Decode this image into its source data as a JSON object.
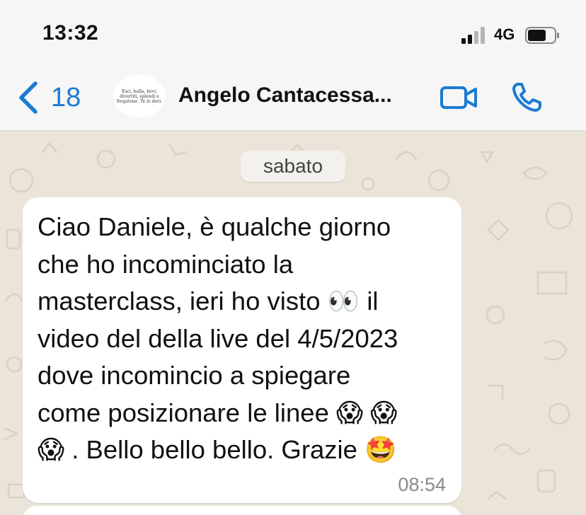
{
  "status_bar": {
    "time": "13:32",
    "network": "4G",
    "signal_icon": "cellular-signal-icon",
    "battery_icon": "battery-icon"
  },
  "header": {
    "back_icon": "chevron-left-icon",
    "back_count": "18",
    "avatar_text": "Esci, balla, bevi, divertiti, splendi e fregatene. Te lo devi.",
    "contact_name": "Angelo Cantacessa...",
    "video_icon": "video-camera-icon",
    "call_icon": "phone-icon",
    "accent_color": "#1a7bd4"
  },
  "chat": {
    "day_label": "sabato",
    "message": {
      "text": "Ciao Daniele, è qualche giorno\nche ho incominciato la\nmasterclass, ieri ho visto 👀 il\nvideo del della live del 4/5/2023\ndove incomincio a spiegare\ncome posizionare le linee 😱 😱\n😱 . Bello bello bello. Grazie 🤩",
      "time": "08:54"
    }
  }
}
